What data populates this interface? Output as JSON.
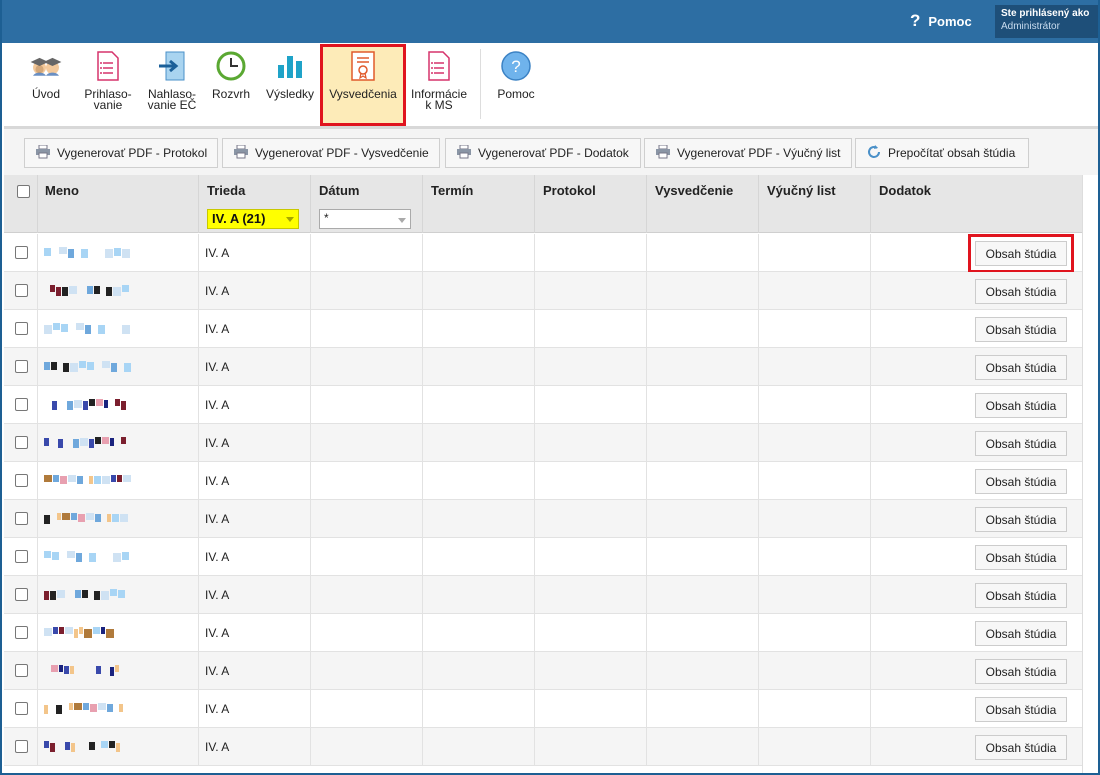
{
  "topbar": {
    "help_label": "Pomoc",
    "help_symbol": "?",
    "user_line1": "Ste prihlásený ako",
    "user_line2": "Administrátor"
  },
  "ribbon": {
    "items": [
      {
        "label": "Úvod",
        "icon": "students-icon"
      },
      {
        "label": "Prihlaso-\nvanie",
        "icon": "form-icon"
      },
      {
        "label": "Nahlaso-\nvanie EČ",
        "icon": "arrow-into-icon"
      },
      {
        "label": "Rozvrh",
        "icon": "clock-icon"
      },
      {
        "label": "Výsledky",
        "icon": "bar-chart-icon"
      },
      {
        "label": "Vysvedčenia",
        "icon": "certificate-icon",
        "selected": true
      },
      {
        "label": "Informácie\nk MS",
        "icon": "info-doc-icon"
      },
      {
        "label": "Pomoc",
        "icon": "help-circle-icon"
      }
    ]
  },
  "toolbar": {
    "buttons": [
      "Vygenerovať PDF - Protokol",
      "Vygenerovať PDF - Vysvedčenie",
      "Vygenerovať PDF - Dodatok",
      "Vygenerovať PDF - Výučný list",
      "Prepočítať obsah štúdia"
    ]
  },
  "table": {
    "headers": [
      "Meno",
      "Trieda",
      "Dátum",
      "Termín",
      "Protokol",
      "Vysvedčenie",
      "Výučný list",
      "Dodatok"
    ],
    "class_filter": "IV. A (21)",
    "date_filter": "*",
    "row_class": "IV. A",
    "row_button": "Obsah štúdia",
    "row_count": 14
  },
  "colors": {
    "topbar": "#2d6ea3",
    "selected_bg": "#fdebb8",
    "highlight": "#e0141e",
    "filter_yellow": "#ffff00"
  }
}
